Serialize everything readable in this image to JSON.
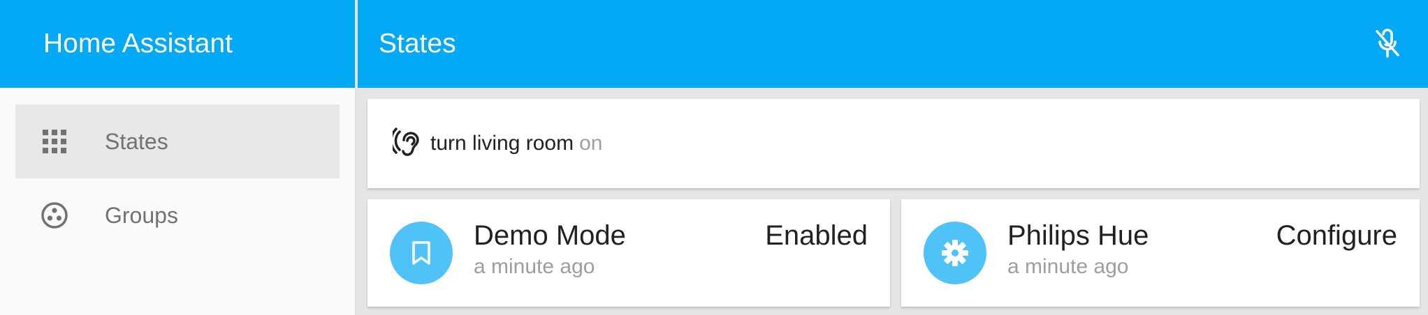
{
  "app": {
    "title": "Home Assistant"
  },
  "sidebar": {
    "items": [
      {
        "label": "States",
        "icon": "apps-grid-icon",
        "active": true
      },
      {
        "label": "Groups",
        "icon": "groups-circle-icon",
        "active": false
      }
    ]
  },
  "toolbar": {
    "title": "States",
    "mic_icon": "mic-off-icon"
  },
  "voice": {
    "final_text": "turn living room",
    "interim_text": "on",
    "icon": "hearing-icon"
  },
  "cards": [
    {
      "name": "Demo Mode",
      "time": "a minute ago",
      "value": "Enabled",
      "icon": "bookmark-icon"
    },
    {
      "name": "Philips Hue",
      "time": "a minute ago",
      "value": "Configure",
      "icon": "gear-icon"
    }
  ],
  "colors": {
    "primary": "#03a9f4",
    "badge": "#4fc3f7",
    "sidebar_bg": "#fafafa",
    "active_item_bg": "#e8e8e8",
    "main_bg": "#e5e5e5"
  }
}
